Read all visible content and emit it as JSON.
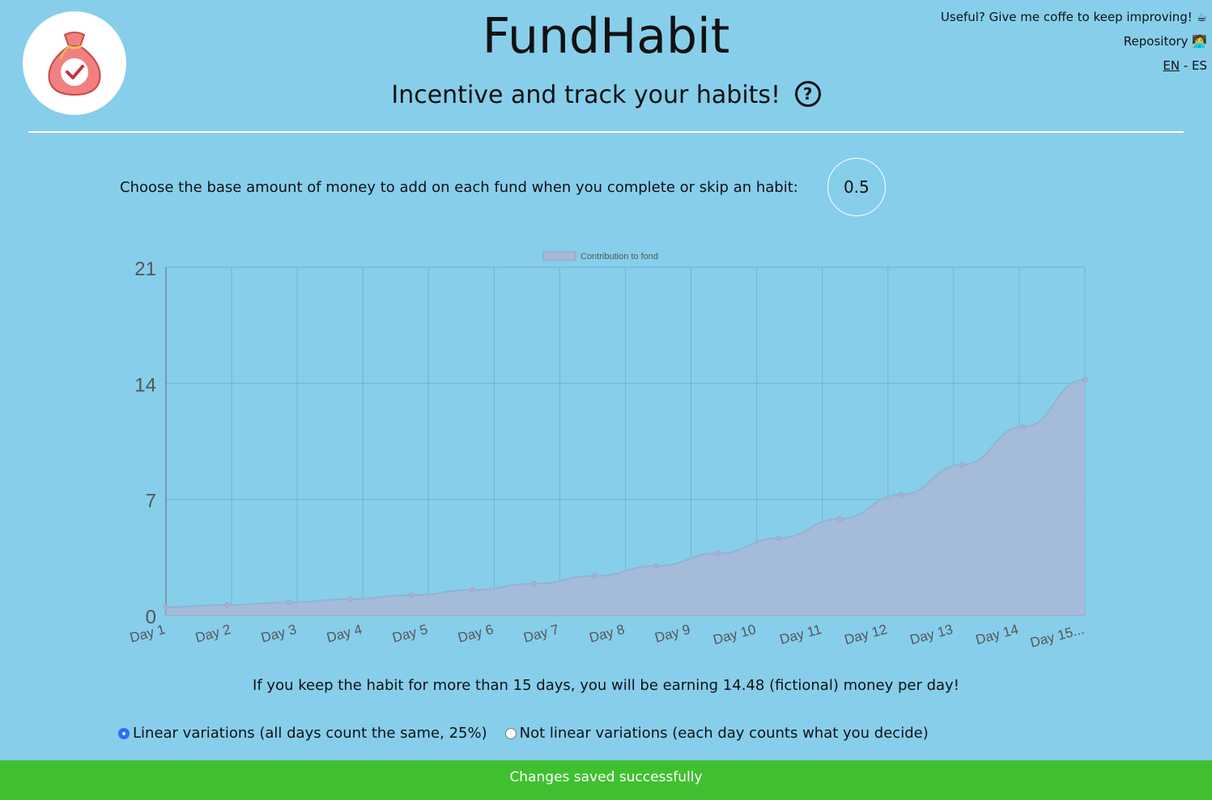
{
  "header": {
    "title": "FundHabit",
    "subtitle": "Incentive and track your habits!",
    "help_icon": "question-circle-icon",
    "logo_icon": "money-bag-check-icon"
  },
  "top_links": {
    "coffee_text": "Useful? Give me coffe to keep improving! ☕",
    "repository_text": "Repository 🧑‍💻",
    "lang_en": "EN",
    "lang_sep": " - ",
    "lang_es": "ES"
  },
  "base_amount": {
    "label": "Choose the base amount of money to add on each fund when you complete or skip an habit:",
    "value": "0.5"
  },
  "chart_data": {
    "type": "area",
    "legend": "Contribution to fond",
    "legend_position": "top-center",
    "grid": true,
    "categories": [
      "Day 1",
      "Day 2",
      "Day 3",
      "Day 4",
      "Day 5",
      "Day 6",
      "Day 7",
      "Day 8",
      "Day 9",
      "Day 10",
      "Day 11",
      "Day 12",
      "Day 13",
      "Day 14",
      "Day 15..."
    ],
    "series": [
      {
        "name": "Contribution to fond",
        "values": [
          0.5,
          0.63,
          0.78,
          0.98,
          1.22,
          1.53,
          1.91,
          2.38,
          2.98,
          3.73,
          4.66,
          5.82,
          7.28,
          9.09,
          11.37,
          14.21
        ]
      }
    ],
    "ylim": [
      0,
      21
    ],
    "yticks": [
      "0",
      "7",
      "14",
      "21"
    ],
    "fill_color": "#a9b8d6",
    "line_color": "#93b3d3"
  },
  "info": {
    "text": "If you keep the habit for more than 15 days, you will be earning 14.48 (fictional) money per day!"
  },
  "variations": {
    "linear_label": "Linear variations (all days count the same, 25%)",
    "nonlinear_label": "Not linear variations (each day counts what you decide)",
    "selected": "linear"
  },
  "toast": {
    "text": "Changes saved successfully",
    "color": "#40c030"
  }
}
